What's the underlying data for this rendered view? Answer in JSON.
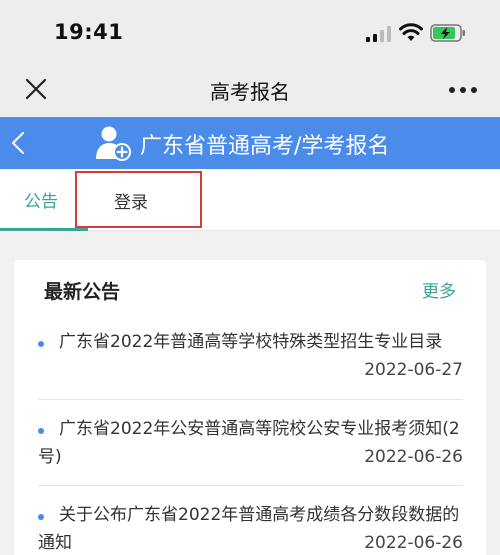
{
  "status_bar": {
    "time": "19:41"
  },
  "title_bar": {
    "title": "高考报名"
  },
  "app_header": {
    "title": "广东省普通高考/学考报名"
  },
  "tabs": [
    {
      "label": "公告",
      "active": true
    },
    {
      "label": "登录",
      "active": false,
      "highlighted": true
    }
  ],
  "notice_card": {
    "title": "最新公告",
    "more_label": "更多",
    "items": [
      {
        "title": "广东省2022年普通高等学校特殊类型招生专业目录",
        "date": "2022-06-27"
      },
      {
        "title": "广东省2022年公安普通高等院校公安专业报考须知(2号)",
        "date": "2022-06-26"
      },
      {
        "title": "关于公布广东省2022年普通高考成绩各分数段数据的通知",
        "date": "2022-06-26"
      }
    ]
  },
  "colors": {
    "accent_blue": "#4b8bea",
    "tab_active": "#3aa39a",
    "highlight_red": "#d93b3b"
  }
}
